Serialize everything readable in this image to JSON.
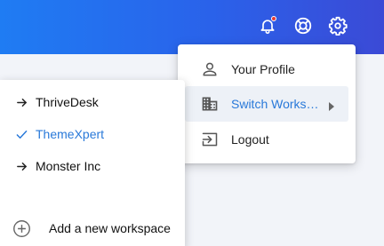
{
  "topbar": {
    "icons": [
      "bell-icon",
      "lifebuoy-icon",
      "gear-icon"
    ],
    "notification_dot_color": "#e53935"
  },
  "profile_menu": {
    "items": [
      {
        "label": "Your Profile",
        "icon": "person-icon"
      },
      {
        "label": "Switch Works…",
        "icon": "building-icon",
        "active": true,
        "has_submenu": true
      },
      {
        "label": "Logout",
        "icon": "logout-icon"
      }
    ]
  },
  "workspace_menu": {
    "items": [
      {
        "label": "ThriveDesk",
        "icon": "arrow-right-icon",
        "selected": false
      },
      {
        "label": "ThemeXpert",
        "icon": "check-icon",
        "selected": true
      },
      {
        "label": "Monster Inc",
        "icon": "arrow-right-icon",
        "selected": false
      }
    ],
    "add_label": "Add a new workspace"
  },
  "colors": {
    "accent": "#2979d9",
    "header_gradient_start": "#1f7cf3",
    "header_gradient_end": "#3b4ad6"
  }
}
